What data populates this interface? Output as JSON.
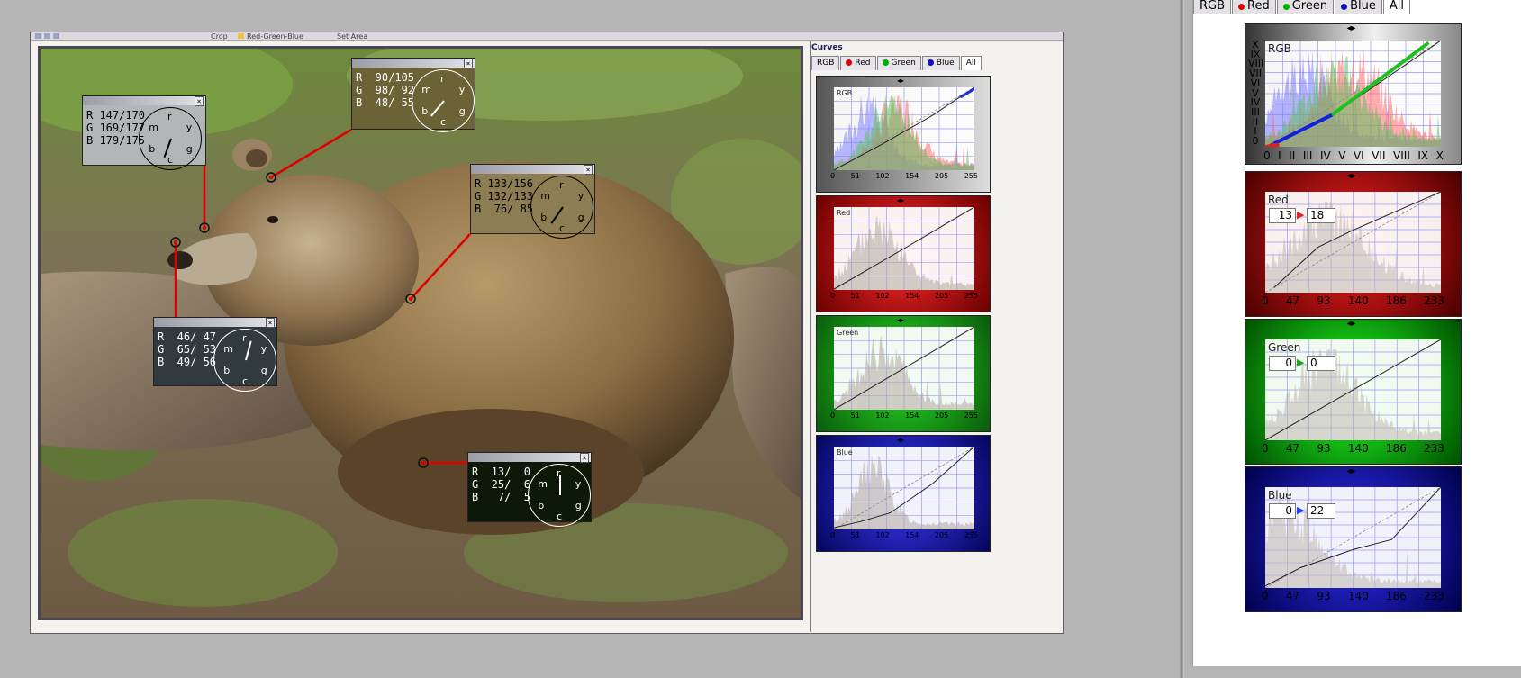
{
  "colors": {
    "red": "#d40000",
    "green": "#00b000",
    "blue": "#1010c0",
    "rgb_bg": "#8e8e8e"
  },
  "main": {
    "toolbar": [
      "Crop",
      "Red-Green-Blue",
      "Set Area"
    ],
    "image_alt": "brown bear lying on a rock",
    "samplers": [
      {
        "id": "snout",
        "r": "R 147/170",
        "g": "G 169/177",
        "b": "B 179/175",
        "bg": "#b2b6b7",
        "fg": "#000000",
        "hand_deg": 200
      },
      {
        "id": "forehead",
        "r": "R  90/105",
        "g": "G  98/ 92",
        "b": "B  48/ 55",
        "bg": "#6b6236",
        "fg": "#ffffff",
        "hand_deg": 220
      },
      {
        "id": "back",
        "r": "R 133/156",
        "g": "G 132/133",
        "b": "B  76/ 85",
        "bg": "#8d7d52",
        "fg": "#000000",
        "hand_deg": 215
      },
      {
        "id": "rock",
        "r": "R  46/ 47",
        "g": "G  65/ 53",
        "b": "B  49/ 56",
        "bg": "#313b3d",
        "fg": "#ffffff",
        "hand_deg": 15
      },
      {
        "id": "shadow",
        "r": "R  13/  0",
        "g": "G  25/  6",
        "b": "B   7/  5",
        "bg": "#0d1908",
        "fg": "#ffffff",
        "hand_deg": 0
      }
    ],
    "dial_letters": [
      "r",
      "y",
      "g",
      "c",
      "b",
      "m"
    ]
  },
  "curves_panel": {
    "title": "Curves",
    "tabs": [
      {
        "label": "RGB",
        "dot": ""
      },
      {
        "label": "Red",
        "dot": "#d40000"
      },
      {
        "label": "Green",
        "dot": "#00b000"
      },
      {
        "label": "Blue",
        "dot": "#1010c0"
      },
      {
        "label": "All",
        "dot": ""
      }
    ],
    "active_tab": "All",
    "charts": [
      {
        "name": "RGB",
        "ticks": [
          "0",
          "51",
          "102",
          "154",
          "205",
          "255"
        ]
      },
      {
        "name": "Red",
        "ticks": [
          "0",
          "51",
          "102",
          "154",
          "205",
          "255"
        ]
      },
      {
        "name": "Green",
        "ticks": [
          "0",
          "51",
          "102",
          "154",
          "205",
          "255"
        ]
      },
      {
        "name": "Blue",
        "ticks": [
          "0",
          "51",
          "102",
          "154",
          "205",
          "255"
        ]
      }
    ]
  },
  "zoom_panel": {
    "tabs": [
      {
        "label": "RGB",
        "dot": ""
      },
      {
        "label": "Red",
        "dot": "#d40000"
      },
      {
        "label": "Green",
        "dot": "#00b000"
      },
      {
        "label": "Blue",
        "dot": "#1010c0"
      },
      {
        "label": "All",
        "dot": ""
      }
    ],
    "active_tab": "All",
    "rgb": {
      "name": "RGB",
      "roman_y": [
        "X",
        "IX",
        "VIII",
        "VII",
        "VI",
        "V",
        "IV",
        "III",
        "II",
        "I",
        "0"
      ],
      "roman_x": [
        "0",
        "I",
        "II",
        "III",
        "IV",
        "V",
        "VI",
        "VII",
        "VIII",
        "IX",
        "X"
      ]
    },
    "red": {
      "name": "Red",
      "in": "13",
      "out": "18",
      "ticks": [
        "0",
        "47",
        "93",
        "140",
        "186",
        "233"
      ]
    },
    "green": {
      "name": "Green",
      "in": "0",
      "out": "0",
      "ticks": [
        "0",
        "47",
        "93",
        "140",
        "186",
        "233"
      ]
    },
    "blue": {
      "name": "Blue",
      "in": "0",
      "out": "22",
      "ticks": [
        "0",
        "47",
        "93",
        "140",
        "186",
        "233"
      ]
    }
  }
}
